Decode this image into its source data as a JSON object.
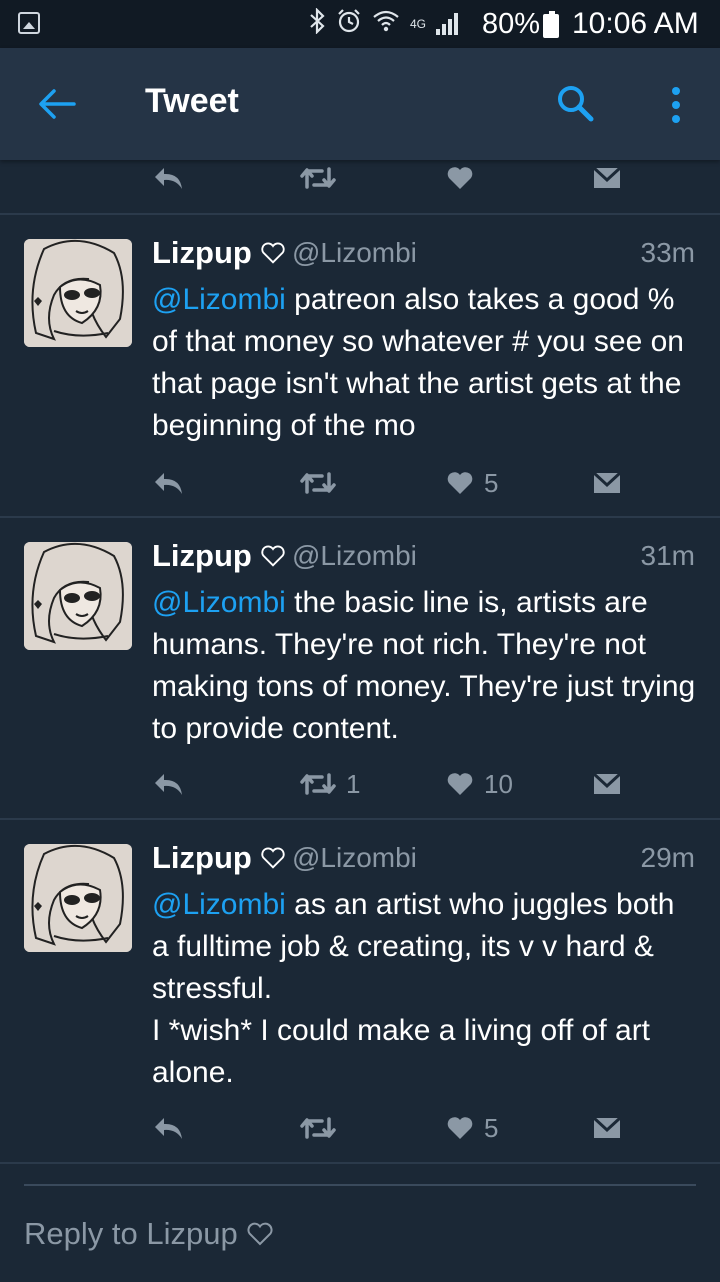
{
  "status_bar": {
    "network": "4G",
    "battery": "80%",
    "time": "10:06 AM"
  },
  "app_bar": {
    "title": "Tweet"
  },
  "top_actions": {
    "likes": "",
    "retweets": ""
  },
  "tweets": [
    {
      "name": "Lizpup",
      "handle": "@Lizombi",
      "time": "33m",
      "mention": "@Lizombi",
      "text": " patreon also takes a good % of that money so whatever # you see on that page isn't what the artist gets at the beginning of the mo",
      "retweets": "",
      "likes": "5"
    },
    {
      "name": "Lizpup",
      "handle": "@Lizombi",
      "time": "31m",
      "mention": "@Lizombi",
      "text": " the basic line is, artists are humans. They're not rich. They're not making tons of money. They're just trying to provide content.",
      "retweets": "1",
      "likes": "10"
    },
    {
      "name": "Lizpup",
      "handle": "@Lizombi",
      "time": "29m",
      "mention": "@Lizombi",
      "text": " as an artist who juggles both a fulltime job & creating, its v v hard & stressful.\nI *wish* I could make a living off of art alone.",
      "retweets": "",
      "likes": "5"
    }
  ],
  "reply": {
    "placeholder": "Reply to Lizpup"
  },
  "colors": {
    "background": "#1b2836",
    "app_bar": "#253446",
    "accent": "#1da1f2",
    "muted": "#8b98a5"
  },
  "icons": [
    "gallery-icon",
    "bluetooth-icon",
    "alarm-icon",
    "wifi-icon",
    "signal-icon",
    "battery-icon",
    "back-arrow-icon",
    "search-icon",
    "more-vert-icon",
    "reply-icon",
    "retweet-icon",
    "like-icon",
    "direct-message-icon",
    "heart-outline-icon"
  ]
}
